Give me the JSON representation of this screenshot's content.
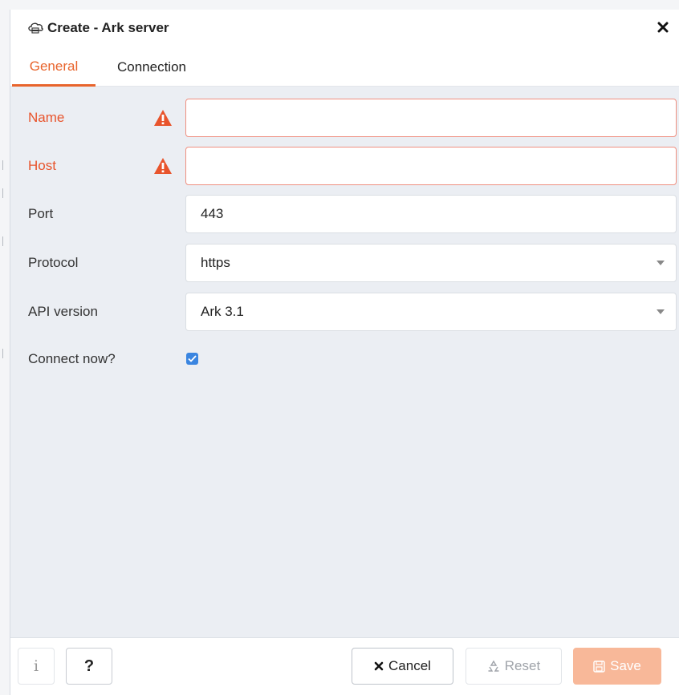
{
  "dialog": {
    "title": "Create - Ark server",
    "title_icon": "cloud-server-icon",
    "close_icon": "close-icon"
  },
  "tabs": [
    {
      "label": "General",
      "active": true
    },
    {
      "label": "Connection",
      "active": false
    }
  ],
  "form": {
    "name": {
      "label": "Name",
      "value": "",
      "error": true
    },
    "host": {
      "label": "Host",
      "value": "",
      "error": true
    },
    "port": {
      "label": "Port",
      "value": "443"
    },
    "protocol": {
      "label": "Protocol",
      "selected": "https"
    },
    "api_version": {
      "label": "API version",
      "selected": "Ark 3.1"
    },
    "connect_now": {
      "label": "Connect now?",
      "checked": true
    }
  },
  "footer": {
    "info_label": "i",
    "help_label": "?",
    "cancel_label": "Cancel",
    "reset_label": "Reset",
    "save_label": "Save"
  },
  "colors": {
    "accent": "#e8642c",
    "error": "#e8542c",
    "checkbox": "#3a85e0",
    "save_disabled": "#f8b899"
  }
}
